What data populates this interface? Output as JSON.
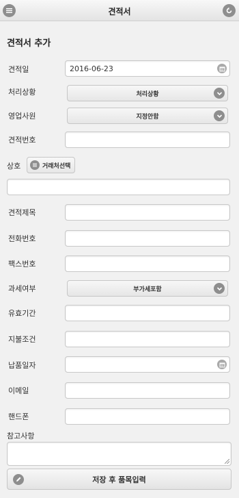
{
  "header": {
    "title": "견적서",
    "menu_icon": "list-icon",
    "back_icon": "back-arrow-icon"
  },
  "form": {
    "title": "견적서 추가",
    "estimate_date": {
      "label": "견적일",
      "value": "2016-06-23"
    },
    "process_status": {
      "label": "처리상황",
      "selected": "처리상황"
    },
    "sales_rep": {
      "label": "영업사원",
      "selected": "지정안함"
    },
    "estimate_no": {
      "label": "견적번호",
      "value": ""
    },
    "company": {
      "label": "상호",
      "button": "거래처선택",
      "value": ""
    },
    "estimate_title": {
      "label": "견적제목",
      "value": ""
    },
    "phone": {
      "label": "전화번호",
      "value": ""
    },
    "fax": {
      "label": "팩스번호",
      "value": ""
    },
    "tax": {
      "label": "과세여부",
      "selected": "부가세포함"
    },
    "validity": {
      "label": "유효기간",
      "value": ""
    },
    "payment": {
      "label": "지불조건",
      "value": ""
    },
    "delivery_date": {
      "label": "납품일자",
      "value": ""
    },
    "email": {
      "label": "이메일",
      "value": ""
    },
    "mobile": {
      "label": "핸드폰",
      "value": ""
    },
    "notes": {
      "label": "참고사항",
      "value": ""
    },
    "save_button": "저장 후 품목입력"
  }
}
